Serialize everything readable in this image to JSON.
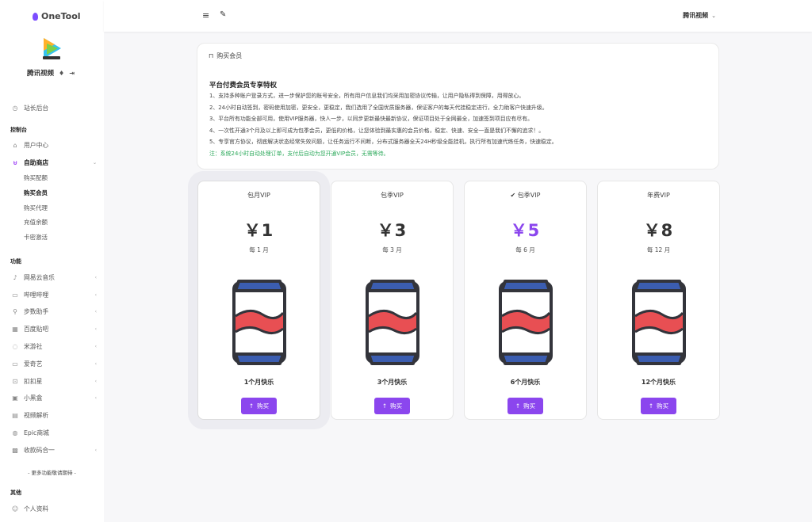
{
  "app": {
    "name": "OneTool"
  },
  "user": {
    "name": "腾讯视频"
  },
  "sidebar": {
    "site_admin": "站长后台",
    "console_title": "控制台",
    "console_items": [
      {
        "label": "用户中心",
        "icon": "user-icon"
      },
      {
        "label": "自助商店",
        "icon": "cart-icon"
      }
    ],
    "shop_sub": [
      "购买配额",
      "购买会员",
      "购买代理",
      "充值余额",
      "卡密激活"
    ],
    "function_title": "功能",
    "function_items": [
      {
        "label": "网易云音乐",
        "icon": "music-icon"
      },
      {
        "label": "哔哩哔哩",
        "icon": "video-icon"
      },
      {
        "label": "步数助手",
        "icon": "steps-icon"
      },
      {
        "label": "百度贴吧",
        "icon": "baidu-icon"
      },
      {
        "label": "米游社",
        "icon": "game-icon"
      },
      {
        "label": "爱奇艺",
        "icon": "tv-icon"
      },
      {
        "label": "扣扣星",
        "icon": "qq-icon"
      },
      {
        "label": "小黑盒",
        "icon": "box-icon"
      },
      {
        "label": "视频解析",
        "icon": "parse-icon"
      },
      {
        "label": "Epic商城",
        "icon": "epic-icon"
      },
      {
        "label": "收款码合一",
        "icon": "qr-icon"
      }
    ],
    "more": "- 更多功能敬请期待 -",
    "other_title": "其他",
    "other_items": [
      {
        "label": "个人资料",
        "icon": "profile-icon"
      }
    ]
  },
  "topbar": {
    "user": "腾讯视频"
  },
  "info": {
    "header": "购买会员",
    "title": "平台付费会员专享特权",
    "lines": [
      "1、支持多种账户登录方式，进一步保护您的账号安全，所有用户信息我们均采用加密协议传输，让用户隐私得到保障，用得放心。",
      "2、24小时自动签到，密码使用加密，更安全，更稳定，我们选用了全国优质服务器，保证客户的每天代挂稳定进行，全力助客户快速升级。",
      "3、平台所有功能全部可用，使用VIP服务器，快人一步，以同步更新最快最新协议，保证项目处于全网最全，加速签到项目应有尽有。",
      "4、一次性开通3个月及以上即可成为包季会员，更低的价格，让您体验到最实惠的会员价格，稳定、快速、安全一直是我们不懈的追求！。",
      "5、专享官方协议，彻底解决状态经常失效问题，让任务运行不间断，分布式服务器全天24H秒级全能挂机，执行所有加速代练任务，快速稳定。"
    ],
    "note": "注：系统24小时自动处理订单，支付后自动为您开通VIP会员，无需等待。"
  },
  "plans": [
    {
      "name": "包月VIP",
      "price": "￥1",
      "period": "每 1 月",
      "desc": "1个月快乐",
      "button": "购买"
    },
    {
      "name": "包季VIP",
      "price": "￥3",
      "period": "每 3 月",
      "desc": "3个月快乐",
      "button": "购买"
    },
    {
      "name": "包季VIP",
      "price": "￥5",
      "period": "每 6 月",
      "desc": "6个月快乐",
      "button": "购买"
    },
    {
      "name": "年费VIP",
      "price": "￥8",
      "period": "每 12 月",
      "desc": "12个月快乐",
      "button": "购买"
    }
  ],
  "colors": {
    "accent": "#8b46ee",
    "note": "#2eaa5c",
    "can_blue": "#3b5db0",
    "can_red": "#e84f53"
  }
}
